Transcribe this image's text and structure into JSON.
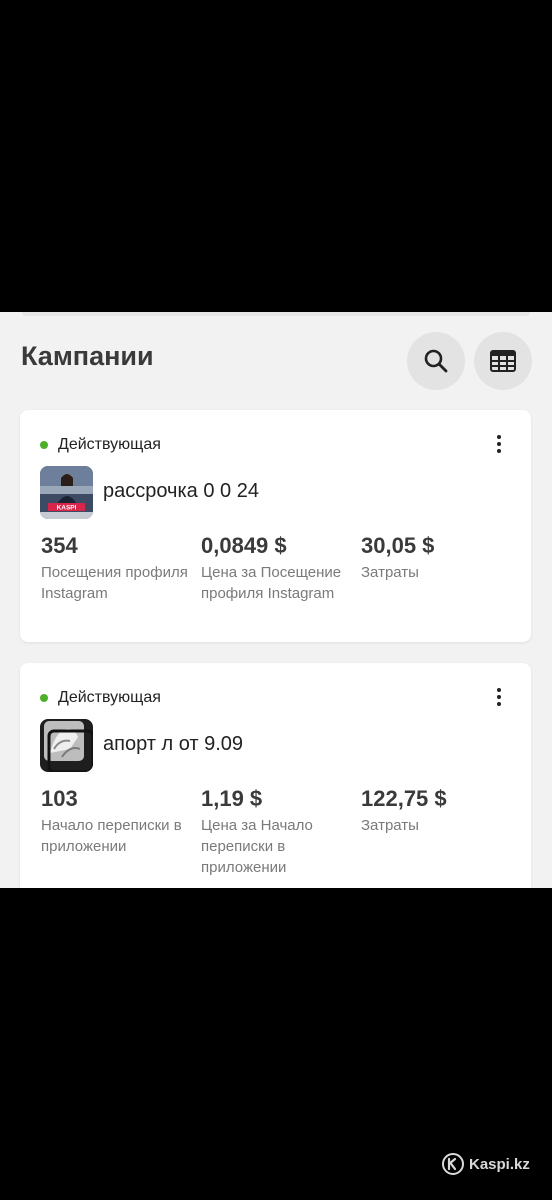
{
  "header": {
    "title": "Кампании",
    "search_icon": "search-icon",
    "table_icon": "table-icon"
  },
  "campaigns": [
    {
      "status": "Действующая",
      "status_color": "#4caf2a",
      "name": "рассрочка 0 0 24",
      "thumb_text": "KASPI",
      "metrics": [
        {
          "value": "354",
          "label": "Посещения профиля Instagram"
        },
        {
          "value": "0,0849 $",
          "label": "Цена за Посещение профиля Instagram"
        },
        {
          "value": "30,05 $",
          "label": "Затраты"
        }
      ]
    },
    {
      "status": "Действующая",
      "status_color": "#4caf2a",
      "name": "апорт л от 9.09",
      "metrics": [
        {
          "value": "103",
          "label": "Начало переписки в приложении"
        },
        {
          "value": "1,19 $",
          "label": "Цена за Начало переписки в приложении"
        },
        {
          "value": "122,75 $",
          "label": "Затраты"
        }
      ]
    }
  ],
  "watermark": {
    "text": "Kaspi.kz"
  }
}
